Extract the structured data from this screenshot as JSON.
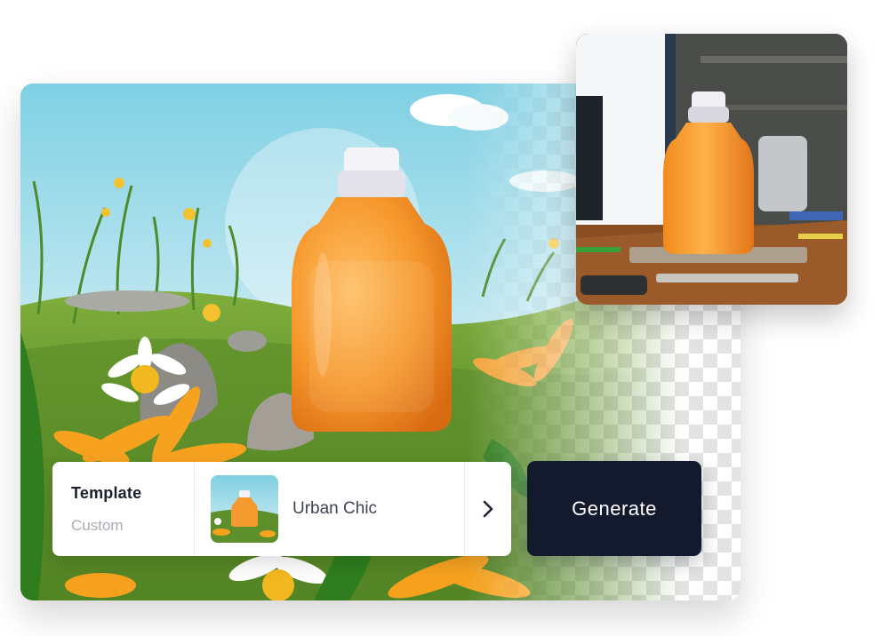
{
  "template_picker": {
    "label": "Template",
    "mode": "Custom",
    "selected_template": "Urban Chic",
    "next_icon": "chevron-right-icon"
  },
  "actions": {
    "generate_label": "Generate"
  },
  "colors": {
    "generate_button": "#141a2e",
    "bottle": "#f59a2f",
    "cap": "#f2f2f6"
  }
}
